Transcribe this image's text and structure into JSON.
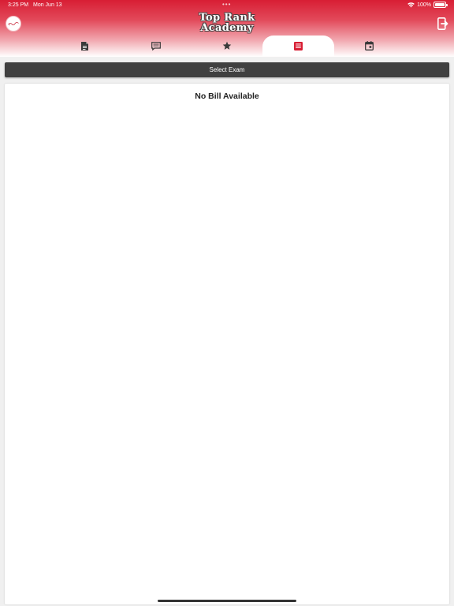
{
  "status": {
    "time": "3:25 PM",
    "date": "Mon Jun 13",
    "battery": "100%",
    "battery_level": 100,
    "multitask_dots": "•••"
  },
  "header": {
    "title_line1": "Top Rank",
    "title_line2": "Academy"
  },
  "tabs": [
    {
      "name": "notes",
      "icon": "document-icon",
      "active": false
    },
    {
      "name": "messages",
      "icon": "message-icon",
      "active": false
    },
    {
      "name": "favorites",
      "icon": "star-icon",
      "active": false
    },
    {
      "name": "bills",
      "icon": "list-icon",
      "active": true
    },
    {
      "name": "calendar",
      "icon": "calendar-icon",
      "active": false
    }
  ],
  "colors": {
    "brand_red": "#d81e34",
    "tab_icon": "#3a3a3a",
    "active_tab_icon": "#d81e34",
    "button_bg": "#404040"
  },
  "main": {
    "select_exam_label": "Select Exam",
    "empty_message": "No Bill Available"
  }
}
